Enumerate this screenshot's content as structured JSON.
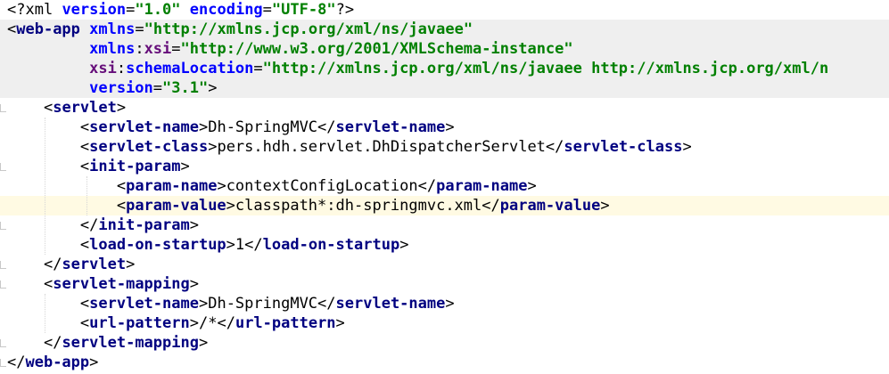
{
  "editor": {
    "language": "xml",
    "colors": {
      "tag_name": "#000080",
      "attribute_name": "#0000ff",
      "attribute_value": "#008000",
      "namespace_prefix": "#660e7a",
      "current_line": "#fffae3",
      "tag_highlight": "#efefef"
    },
    "lines": [
      {
        "segments": [
          {
            "t": "<?",
            "c": "pi"
          },
          {
            "t": "xml ",
            "c": "pi"
          },
          {
            "t": "version",
            "c": "aname"
          },
          {
            "t": "=",
            "c": "text"
          },
          {
            "t": "\"1.0\"",
            "c": "aval"
          },
          {
            "t": " ",
            "c": "text"
          },
          {
            "t": "encoding",
            "c": "aname"
          },
          {
            "t": "=",
            "c": "text"
          },
          {
            "t": "\"UTF-8\"",
            "c": "aval"
          },
          {
            "t": "?>",
            "c": "pi"
          }
        ]
      },
      {
        "segments": [
          {
            "t": "<",
            "c": "bracket"
          },
          {
            "t": "web-app",
            "c": "tname"
          },
          {
            "t": " ",
            "c": "text"
          },
          {
            "t": "xmlns",
            "c": "aname"
          },
          {
            "t": "=",
            "c": "text"
          },
          {
            "t": "\"http://xmlns.jcp.org/xml/ns/javaee\"",
            "c": "aval"
          }
        ]
      },
      {
        "segments": [
          {
            "t": "         ",
            "c": "text"
          },
          {
            "t": "xmlns",
            "c": "aname"
          },
          {
            "t": ":",
            "c": "text"
          },
          {
            "t": "xsi",
            "c": "nsname"
          },
          {
            "t": "=",
            "c": "text"
          },
          {
            "t": "\"http://www.w3.org/2001/XMLSchema-instance\"",
            "c": "aval"
          }
        ]
      },
      {
        "segments": [
          {
            "t": "         ",
            "c": "text"
          },
          {
            "t": "xsi",
            "c": "nsname"
          },
          {
            "t": ":",
            "c": "text"
          },
          {
            "t": "schemaLocation",
            "c": "aname"
          },
          {
            "t": "=",
            "c": "text"
          },
          {
            "t": "\"http://xmlns.jcp.org/xml/ns/javaee http://xmlns.jcp.org/xml/n",
            "c": "aval"
          }
        ]
      },
      {
        "segments": [
          {
            "t": "         ",
            "c": "text"
          },
          {
            "t": "version",
            "c": "aname"
          },
          {
            "t": "=",
            "c": "text"
          },
          {
            "t": "\"3.1\"",
            "c": "aval"
          },
          {
            "t": ">",
            "c": "bracket"
          }
        ]
      },
      {
        "segments": [
          {
            "t": "    ",
            "c": "text"
          },
          {
            "t": "<",
            "c": "bracket"
          },
          {
            "t": "servlet",
            "c": "tname"
          },
          {
            "t": ">",
            "c": "bracket"
          }
        ]
      },
      {
        "segments": [
          {
            "t": "        ",
            "c": "text"
          },
          {
            "t": "<",
            "c": "bracket"
          },
          {
            "t": "servlet-name",
            "c": "tname"
          },
          {
            "t": ">",
            "c": "bracket"
          },
          {
            "t": "Dh-SpringMVC",
            "c": "text"
          },
          {
            "t": "</",
            "c": "bracket"
          },
          {
            "t": "servlet-name",
            "c": "tname"
          },
          {
            "t": ">",
            "c": "bracket"
          }
        ]
      },
      {
        "segments": [
          {
            "t": "        ",
            "c": "text"
          },
          {
            "t": "<",
            "c": "bracket"
          },
          {
            "t": "servlet-class",
            "c": "tname"
          },
          {
            "t": ">",
            "c": "bracket"
          },
          {
            "t": "pers.hdh.servlet.DhDispatcherServlet",
            "c": "text"
          },
          {
            "t": "</",
            "c": "bracket"
          },
          {
            "t": "servlet-class",
            "c": "tname"
          },
          {
            "t": ">",
            "c": "bracket"
          }
        ]
      },
      {
        "segments": [
          {
            "t": "        ",
            "c": "text"
          },
          {
            "t": "<",
            "c": "bracket"
          },
          {
            "t": "init-param",
            "c": "tname"
          },
          {
            "t": ">",
            "c": "bracket"
          }
        ]
      },
      {
        "segments": [
          {
            "t": "            ",
            "c": "text"
          },
          {
            "t": "<",
            "c": "bracket"
          },
          {
            "t": "param-name",
            "c": "tname"
          },
          {
            "t": ">",
            "c": "bracket"
          },
          {
            "t": "contextConfigLocation",
            "c": "text"
          },
          {
            "t": "</",
            "c": "bracket"
          },
          {
            "t": "param-name",
            "c": "tname"
          },
          {
            "t": ">",
            "c": "bracket"
          }
        ]
      },
      {
        "segments": [
          {
            "t": "            ",
            "c": "text"
          },
          {
            "t": "<",
            "c": "bracket"
          },
          {
            "t": "param-value",
            "c": "tname"
          },
          {
            "t": ">",
            "c": "bracket"
          },
          {
            "t": "classpath*:dh-springmvc.xml",
            "c": "text"
          },
          {
            "t": "</",
            "c": "bracket"
          },
          {
            "t": "param-value",
            "c": "tname"
          },
          {
            "t": ">",
            "c": "bracket"
          }
        ]
      },
      {
        "segments": [
          {
            "t": "        ",
            "c": "text"
          },
          {
            "t": "</",
            "c": "bracket"
          },
          {
            "t": "init-param",
            "c": "tname"
          },
          {
            "t": ">",
            "c": "bracket"
          }
        ]
      },
      {
        "segments": [
          {
            "t": "        ",
            "c": "text"
          },
          {
            "t": "<",
            "c": "bracket"
          },
          {
            "t": "load-on-startup",
            "c": "tname"
          },
          {
            "t": ">",
            "c": "bracket"
          },
          {
            "t": "1",
            "c": "text"
          },
          {
            "t": "</",
            "c": "bracket"
          },
          {
            "t": "load-on-startup",
            "c": "tname"
          },
          {
            "t": ">",
            "c": "bracket"
          }
        ]
      },
      {
        "segments": [
          {
            "t": "    ",
            "c": "text"
          },
          {
            "t": "</",
            "c": "bracket"
          },
          {
            "t": "servlet",
            "c": "tname"
          },
          {
            "t": ">",
            "c": "bracket"
          }
        ]
      },
      {
        "segments": [
          {
            "t": "    ",
            "c": "text"
          },
          {
            "t": "<",
            "c": "bracket"
          },
          {
            "t": "servlet-mapping",
            "c": "tname"
          },
          {
            "t": ">",
            "c": "bracket"
          }
        ]
      },
      {
        "segments": [
          {
            "t": "        ",
            "c": "text"
          },
          {
            "t": "<",
            "c": "bracket"
          },
          {
            "t": "servlet-name",
            "c": "tname"
          },
          {
            "t": ">",
            "c": "bracket"
          },
          {
            "t": "Dh-SpringMVC",
            "c": "text"
          },
          {
            "t": "</",
            "c": "bracket"
          },
          {
            "t": "servlet-name",
            "c": "tname"
          },
          {
            "t": ">",
            "c": "bracket"
          }
        ]
      },
      {
        "segments": [
          {
            "t": "        ",
            "c": "text"
          },
          {
            "t": "<",
            "c": "bracket"
          },
          {
            "t": "url-pattern",
            "c": "tname"
          },
          {
            "t": ">",
            "c": "bracket"
          },
          {
            "t": "/*",
            "c": "text"
          },
          {
            "t": "</",
            "c": "bracket"
          },
          {
            "t": "url-pattern",
            "c": "tname"
          },
          {
            "t": ">",
            "c": "bracket"
          }
        ]
      },
      {
        "segments": [
          {
            "t": "    ",
            "c": "text"
          },
          {
            "t": "</",
            "c": "bracket"
          },
          {
            "t": "servlet-mapping",
            "c": "tname"
          },
          {
            "t": ">",
            "c": "bracket"
          }
        ]
      },
      {
        "segments": [
          {
            "t": "</",
            "c": "bracket"
          },
          {
            "t": "web-app",
            "c": "tname"
          },
          {
            "t": ">",
            "c": "bracket"
          }
        ]
      }
    ]
  }
}
